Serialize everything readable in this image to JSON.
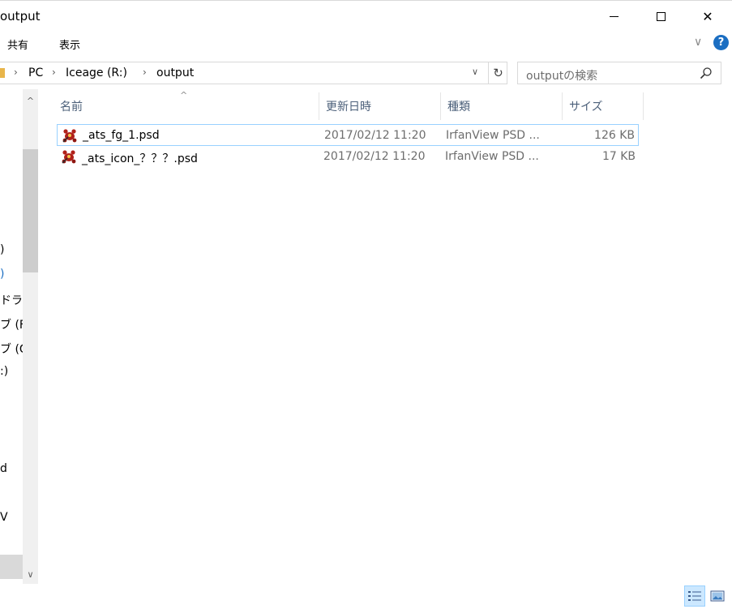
{
  "window": {
    "title": "output",
    "minimize_label": "",
    "maximize_label": "",
    "close_label": "✕"
  },
  "ribbon": {
    "tabs": [
      "共有",
      "表示"
    ],
    "collapse_glyph": "∨",
    "help_glyph": "?"
  },
  "address": {
    "crumbs": [
      "PC",
      "Iceage (R:)",
      "output"
    ],
    "separator": "›",
    "dropdown_glyph": "∨",
    "refresh_glyph": "↻"
  },
  "search": {
    "placeholder": "outputの検索"
  },
  "nav": {
    "scroll_up": "^",
    "scroll_down": "∨",
    "items": [
      {
        "label": ")"
      },
      {
        "label": ")"
      },
      {
        "label": "ドライ"
      },
      {
        "label": "ブ (F"
      },
      {
        "label": "ブ (G"
      },
      {
        "label": ":)"
      },
      {
        "label": "d"
      },
      {
        "label": "V"
      }
    ]
  },
  "columns": {
    "name": "名前",
    "date": "更新日時",
    "type": "種類",
    "size": "サイズ",
    "sort_glyph": "^"
  },
  "files": [
    {
      "name": "_ats_fg_1.psd",
      "modified": "2017/02/12 11:20",
      "type": "IrfanView PSD ...",
      "size": "126 KB",
      "icon": "irfanview-psd-icon"
    },
    {
      "name": "_ats_icon_？？？.psd",
      "modified": "2017/02/12 11:20",
      "type": "IrfanView PSD ...",
      "size": "17 KB",
      "icon": "irfanview-psd-icon"
    }
  ],
  "colors": {
    "selection_border": "#99d1ff",
    "header_text": "#4c607a",
    "help_blue": "#1b6ec2"
  }
}
